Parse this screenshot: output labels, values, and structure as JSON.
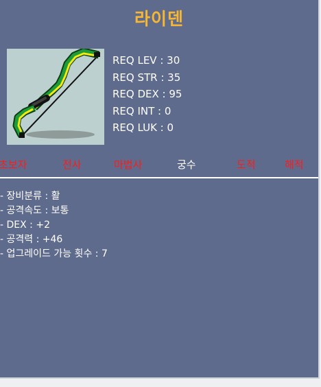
{
  "item": {
    "name": "라이덴"
  },
  "colors": {
    "title": "#f7b733",
    "panel_bg": "#5f6b8c",
    "class_enabled": "#ffffff",
    "class_disabled": "#ff1a1a"
  },
  "requirements": [
    "REQ LEV : 30",
    "REQ STR : 35",
    "REQ DEX : 95",
    "REQ INT : 0",
    "REQ LUK : 0"
  ],
  "classes": [
    {
      "label": "초보자",
      "color": "#ff1a1a"
    },
    {
      "label": "전사",
      "color": "#ff1a1a"
    },
    {
      "label": "마법사",
      "color": "#ff1a1a"
    },
    {
      "label": "궁수",
      "color": "#ffffff"
    },
    {
      "label": "도적",
      "color": "#ff1a1a"
    },
    {
      "label": "해적",
      "color": "#ff1a1a"
    }
  ],
  "stats": [
    "- 장비분류 : 활",
    "- 공격속도 : 보통",
    "- DEX : +2",
    "- 공격력 : +46",
    "- 업그레이드 가능 횟수 : 7"
  ],
  "icons": {
    "item_image": "bow-icon"
  }
}
